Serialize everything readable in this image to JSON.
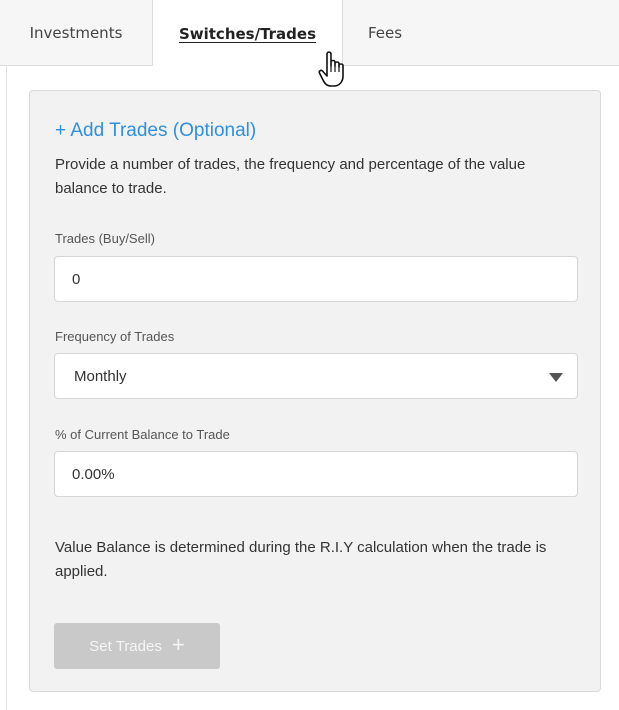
{
  "tabs": [
    {
      "label": "Investments"
    },
    {
      "label": "Switches/Trades"
    },
    {
      "label": "Fees"
    }
  ],
  "card": {
    "add_link": "+ Add Trades (Optional)",
    "description": "Provide a number of trades, the frequency and percentage of the value balance to trade.",
    "trades_label": "Trades (Buy/Sell)",
    "trades_value": "0",
    "frequency_label": "Frequency of Trades",
    "frequency_value": "Monthly",
    "percent_label": "% of Current Balance to Trade",
    "percent_value": "0.00%",
    "note": "Value Balance is determined during the R.I.Y calculation when the trade is applied.",
    "set_trades_label": "Set Trades",
    "set_trades_icon": "+"
  },
  "colors": {
    "link": "#2f8fe0",
    "card_bg": "#f2f2f2",
    "button_disabled": "#c9c9c9"
  }
}
